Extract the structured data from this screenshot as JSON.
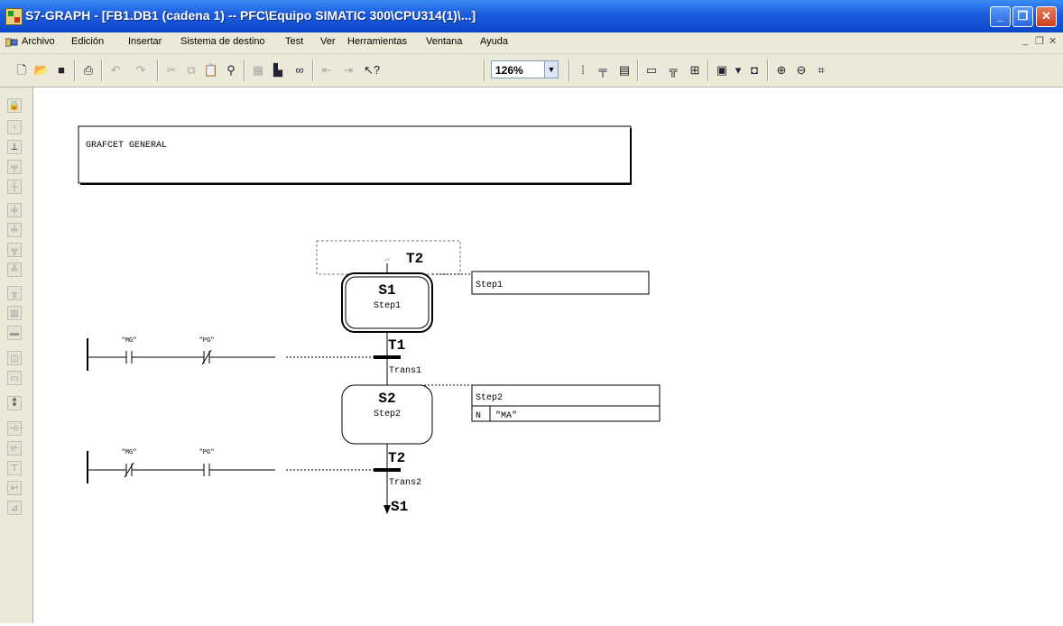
{
  "window": {
    "title": "S7-GRAPH - [FB1.DB1 (cadena 1) -- PFC\\Equipo SIMATIC 300\\CPU314(1)\\...]",
    "buttons": {
      "minimize": "_",
      "maximize": "❐",
      "close": "✕"
    }
  },
  "menu": {
    "items": [
      "Archivo",
      "Edición",
      "Insertar",
      "Sistema de destino",
      "Test",
      "Ver",
      "Herramientas",
      "Ventana",
      "Ayuda"
    ],
    "mdi_controls": {
      "minimize": "_",
      "restore": "❐",
      "close": "✕"
    }
  },
  "toolbar": {
    "zoom_value": "126%",
    "icons": [
      "new-icon",
      "open-icon",
      "save-icon",
      "print-icon",
      "undo-icon",
      "redo-icon",
      "cut-icon",
      "copy-icon",
      "paste-icon",
      "find-icon",
      "monitor-icon",
      "download-icon",
      "glasses-icon",
      "step-back-icon",
      "step-forward-icon",
      "help-pointer-icon",
      "zoom-dropdown",
      "sequencer-icon",
      "transition-view-icon",
      "step-view-icon",
      "comment-view-icon",
      "symbol-view-icon",
      "overview-icon",
      "window-icon",
      "window-dropdown-icon",
      "ladder-icon",
      "zoom-in-icon",
      "zoom-out-icon",
      "fit-icon"
    ]
  },
  "leftbar": {
    "icons": [
      "lock-icon",
      "step-transition-icon",
      "step-icon",
      "branch-icon",
      "jump-icon",
      "alt-branch-icon",
      "alt-branch-close-icon",
      "sim-branch-icon",
      "sim-branch-close-icon",
      "jump-target-icon",
      "chain-end-icon",
      "contact-no-icon",
      "contact-nc-icon",
      "box-icon",
      "coil-icon",
      "comparator-icon",
      "grid-icon",
      "zoom-step-icon",
      "contact-icon",
      "negated-contact-icon",
      "box2-icon",
      "coil2-icon",
      "sequence-icon"
    ]
  },
  "graph": {
    "header_comment": "GRAFCET GENERAL",
    "top_jump_label": "T2",
    "top_jump_arrow": "←",
    "steps": [
      {
        "id": "S1",
        "name": "Step1",
        "comment": "Step1",
        "actions": [],
        "initial": true
      },
      {
        "id": "S2",
        "name": "Step2",
        "comment": "Step2",
        "actions": [
          {
            "qualifier": "N",
            "operand": "\"MA\""
          }
        ],
        "initial": false
      }
    ],
    "transitions": [
      {
        "id": "T1",
        "name": "Trans1",
        "contacts": [
          {
            "symbol": "\"MG\"",
            "type": "no"
          },
          {
            "symbol": "\"PG\"",
            "type": "nc"
          }
        ]
      },
      {
        "id": "T2",
        "name": "Trans2",
        "contacts": [
          {
            "symbol": "\"MG\"",
            "type": "nc"
          },
          {
            "symbol": "\"PG\"",
            "type": "no"
          }
        ]
      }
    ],
    "end_jump": "S1"
  }
}
